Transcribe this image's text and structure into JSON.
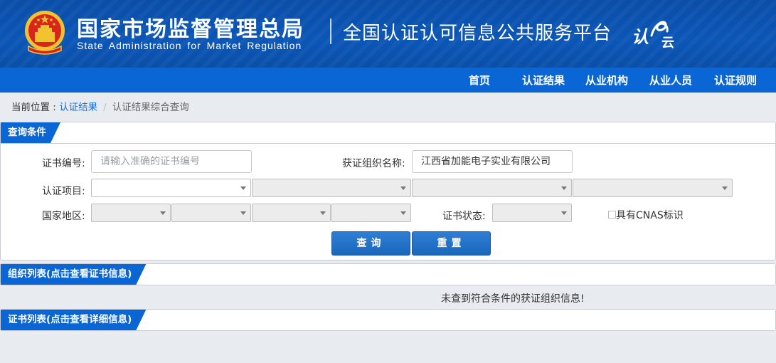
{
  "header": {
    "org_cn": "国家市场监督管理总局",
    "org_en": "State Administration for Market Regulation",
    "platform_title": "全国认证认可信息公共服务平台",
    "logo_text_1": "认",
    "logo_text_2": "云"
  },
  "nav": {
    "items": [
      {
        "label": "首页"
      },
      {
        "label": "认证结果"
      },
      {
        "label": "从业机构"
      },
      {
        "label": "从业人员"
      },
      {
        "label": "认证规则"
      }
    ]
  },
  "breadcrumb": {
    "prefix": "当前位置 : ",
    "link": "认证结果",
    "separator": "/",
    "current": "认证结果综合查询"
  },
  "query_panel": {
    "title": "查询条件",
    "cert_no_label": "证书编号:",
    "cert_no_placeholder": "请输入准确的证书编号",
    "org_name_label": "获证组织名称:",
    "org_name_value": "江西省加能电子实业有限公司",
    "cert_item_label": "认证项目:",
    "region_label": "国家地区:",
    "cert_status_label": "证书状态:",
    "cnas_label": "具有CNAS标识",
    "search_button": "查询",
    "reset_button": "重置"
  },
  "org_list_panel": {
    "title": "组织列表(点击查看证书信息)",
    "empty_message": "未查到符合条件的获证组织信息!"
  },
  "cert_list_panel": {
    "title": "证书列表(点击查看详细信息)"
  },
  "colors": {
    "header_blue": "#0b56b6",
    "nav_blue": "#0a66d4",
    "button_blue": "#1a67bd",
    "emblem_red": "#d8261c",
    "emblem_gold": "#f2c230"
  }
}
